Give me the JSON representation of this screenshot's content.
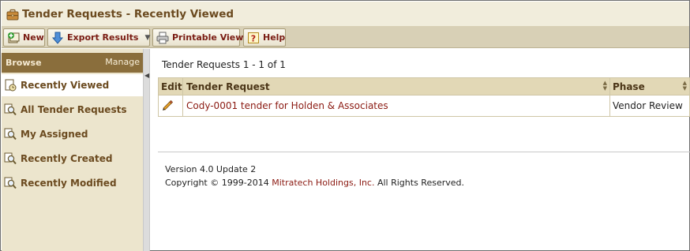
{
  "window": {
    "title": "Tender Requests - Recently Viewed",
    "title_icon": "briefcase-icon"
  },
  "toolbar": {
    "new_label": "New",
    "export_label": "Export Results",
    "printable_label": "Printable View",
    "help_label": "Help"
  },
  "sidebar": {
    "browse_label": "Browse",
    "manage_label": "Manage",
    "items": [
      {
        "label": "Recently Viewed",
        "icon": "recent-page-icon",
        "active": true
      },
      {
        "label": "All Tender Requests",
        "icon": "magnifier-icon"
      },
      {
        "label": "My Assigned",
        "icon": "magnifier-icon"
      },
      {
        "label": "Recently Created",
        "icon": "magnifier-icon"
      },
      {
        "label": "Recently Modified",
        "icon": "magnifier-icon"
      }
    ]
  },
  "main": {
    "count_text": "Tender Requests 1 - 1 of 1",
    "table": {
      "columns": [
        "Edit",
        "Tender Request",
        "Phase"
      ],
      "rows": [
        {
          "tender_request": "Cody-0001 tender for Holden & Associates",
          "phase": "Vendor Review"
        }
      ]
    },
    "footer": {
      "version": "Version 4.0 Update 2",
      "copyright_prefix": "Copyright © 1999-2014 ",
      "company": "Mitratech Holdings, Inc.",
      "copyright_suffix": " All Rights Reserved."
    }
  },
  "colors": {
    "title_text": "#6b4a1f",
    "toolbar_text": "#7a1c14",
    "sidebar_header": "#8a6e3c",
    "link": "#8b1a12"
  }
}
